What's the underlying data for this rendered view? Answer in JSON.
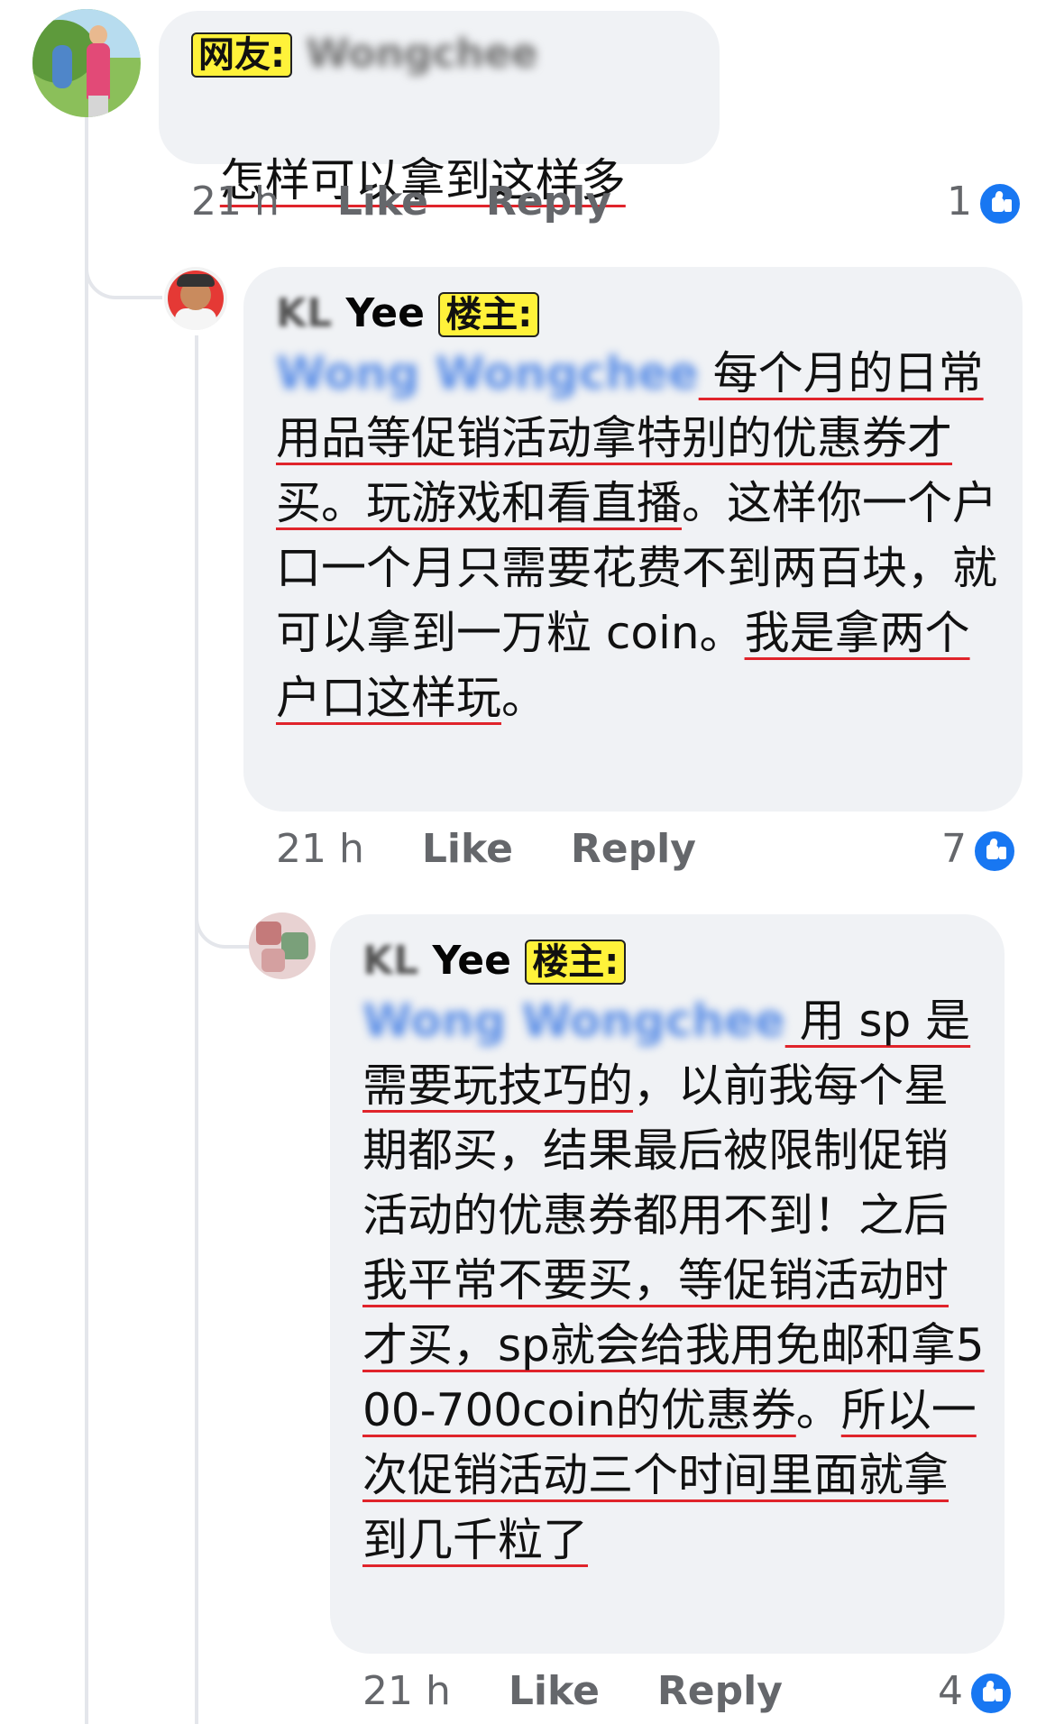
{
  "comment1": {
    "label": "网友:",
    "author": "Wongchee",
    "text": "怎样可以拿到这样多",
    "time": "21 h",
    "like": "Like",
    "reply": "Reply",
    "reactions": "1"
  },
  "comment2": {
    "author_initials": "KL",
    "author_name": "Yee",
    "label": "楼主:",
    "mention": "Wong Wongchee",
    "text_part1": " 每个月的日常用品等促销活动拿特别的优惠券才买。玩游戏和看直播",
    "text_part2": "。这样你一个户口一个月只需要花费不到两百块，就可以拿到一万粒 coin。",
    "text_part3": "我是拿两个户口这样玩",
    "text_part4": "。",
    "time": "21 h",
    "like": "Like",
    "reply": "Reply",
    "reactions": "7"
  },
  "comment3": {
    "author_initials": "KL",
    "author_name": "Yee",
    "label": "楼主:",
    "mention": "Wong Wongchee",
    "text_part1": " 用 sp 是需要玩技巧的",
    "text_part2": "，以前我每个星期都买，结果最后被限制促销活动的优惠券都用不到！之后",
    "text_part3": "我平常不要买，等促销活动时才买，sp就会给我用免邮和拿500-700coin的优惠券",
    "text_part4": "。",
    "text_part5": "所以一次促销活动三个时间里面就拿到几千粒了",
    "time": "21 h",
    "like": "Like",
    "reply": "Reply",
    "reactions": "4"
  },
  "colors": {
    "bubble": "#f0f2f5",
    "underline": "#e0242b",
    "label_bg": "#fff23a",
    "like_blue": "#1877f2",
    "meta_gray": "#65676b"
  },
  "icons": {
    "reaction": "thumbs-up-icon"
  }
}
